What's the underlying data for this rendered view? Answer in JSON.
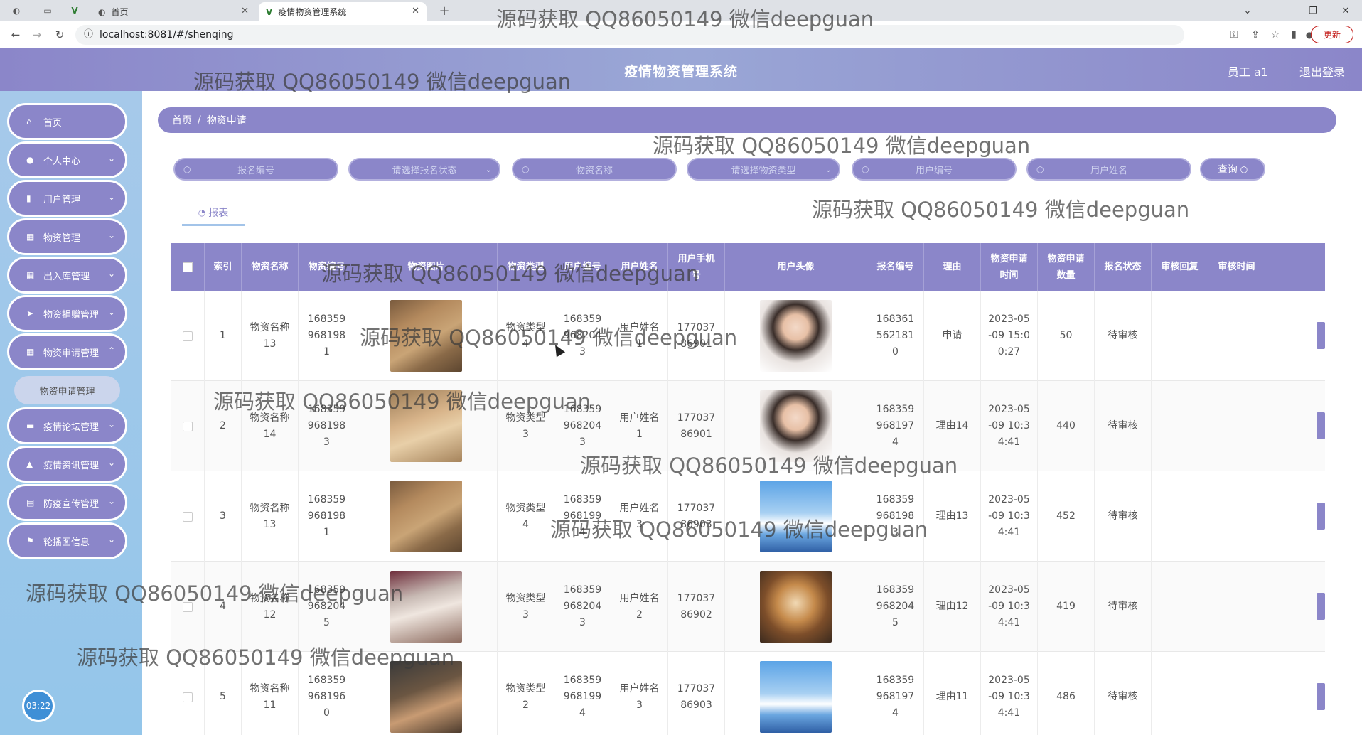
{
  "browser": {
    "tabs": [
      {
        "label": "首页"
      },
      {
        "label": "疫情物资管理系统"
      }
    ],
    "new_tab": "+",
    "url": "localhost:8081/#/shenqing",
    "update_label": "更新"
  },
  "header": {
    "title": "疫情物资管理系统",
    "user": "员工 a1",
    "logout": "退出登录"
  },
  "sidebar": {
    "items": [
      {
        "label": "首页",
        "icon": "home-icon"
      },
      {
        "label": "个人中心",
        "icon": "user-icon"
      },
      {
        "label": "用户管理",
        "icon": "bar-chart-icon"
      },
      {
        "label": "物资管理",
        "icon": "grid-icon"
      },
      {
        "label": "出入库管理",
        "icon": "grid-icon"
      },
      {
        "label": "物资捐赠管理",
        "icon": "send-icon"
      },
      {
        "label": "物资申请管理",
        "icon": "grid-icon"
      },
      {
        "label": "疫情论坛管理",
        "icon": "monitor-icon"
      },
      {
        "label": "疫情资讯管理",
        "icon": "chart-icon"
      },
      {
        "label": "防疫宣传管理",
        "icon": "news-icon"
      },
      {
        "label": "轮播图信息",
        "icon": "flag-icon"
      }
    ],
    "submenu_label": "物资申请管理",
    "clock": "03:22"
  },
  "breadcrumb": {
    "home": "首页",
    "separator": "/",
    "current": "物资申请"
  },
  "search": {
    "baoming_placeholder": "报名编号",
    "status_placeholder": "请选择报名状态",
    "wuzi_placeholder": "物资名称",
    "type_placeholder": "请选择物资类型",
    "user_no_placeholder": "用户编号",
    "user_name_placeholder": "用户姓名",
    "query_label": "查询"
  },
  "report_tab": "报表",
  "table": {
    "columns": [
      "索引",
      "物资名称",
      "物资编号",
      "物资图片",
      "物资类型",
      "用户编号",
      "用户姓名",
      "用户手机号",
      "用户头像",
      "报名编号",
      "理由",
      "物资申请时间",
      "物资申请数量",
      "报名状态",
      "审核回复",
      "审核时间"
    ],
    "rows": [
      {
        "index": "1",
        "name": "物资名称13",
        "wuzi_no": "1683599681981",
        "type": "物资类型4",
        "user_no": "1683599682043",
        "user_name": "用户姓名1",
        "phone": "17703786901",
        "baoming_no": "1683615621810",
        "reason": "申请",
        "time": "2023-05-09 15:00:27",
        "qty": "50",
        "status": "待审核",
        "reply": "",
        "review_time": ""
      },
      {
        "index": "2",
        "name": "物资名称14",
        "wuzi_no": "1683599681983",
        "type": "物资类型3",
        "user_no": "1683599682043",
        "user_name": "用户姓名1",
        "phone": "17703786901",
        "baoming_no": "1683599681974",
        "reason": "理由14",
        "time": "2023-05-09 10:34:41",
        "qty": "440",
        "status": "待审核",
        "reply": "",
        "review_time": ""
      },
      {
        "index": "3",
        "name": "物资名称13",
        "wuzi_no": "1683599681981",
        "type": "物资类型4",
        "user_no": "1683599681994",
        "user_name": "用户姓名3",
        "phone": "17703786903",
        "baoming_no": "1683599681983",
        "reason": "理由13",
        "time": "2023-05-09 10:34:41",
        "qty": "452",
        "status": "待审核",
        "reply": "",
        "review_time": ""
      },
      {
        "index": "4",
        "name": "物资名称12",
        "wuzi_no": "1683599682045",
        "type": "物资类型3",
        "user_no": "1683599682043",
        "user_name": "用户姓名2",
        "phone": "17703786902",
        "baoming_no": "1683599682045",
        "reason": "理由12",
        "time": "2023-05-09 10:34:41",
        "qty": "419",
        "status": "待审核",
        "reply": "",
        "review_time": ""
      },
      {
        "index": "5",
        "name": "物资名称11",
        "wuzi_no": "1683599681960",
        "type": "物资类型2",
        "user_no": "1683599681994",
        "user_name": "用户姓名3",
        "phone": "17703786903",
        "baoming_no": "1683599681974",
        "reason": "理由11",
        "time": "2023-05-09 10:34:41",
        "qty": "486",
        "status": "待审核",
        "reply": "",
        "review_time": ""
      }
    ]
  },
  "watermark": "源码获取 QQ86050149 微信deepguan",
  "colors": {
    "primary": "#8b86c9",
    "sidebar_bg": "#a6c9ea",
    "tab_underline": "#a3c4e9"
  }
}
